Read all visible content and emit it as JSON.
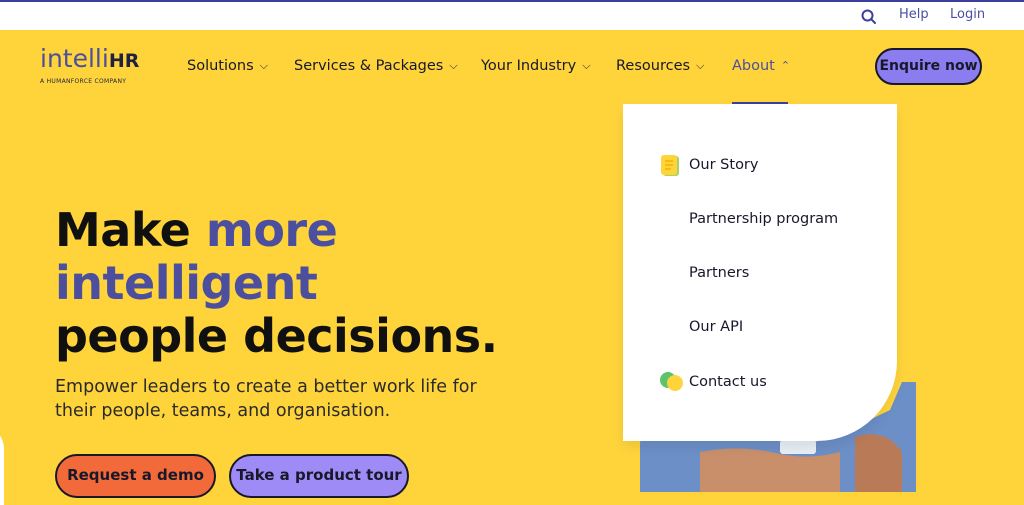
{
  "utility": {
    "search_icon": "search-icon",
    "help": "Help",
    "login": "Login"
  },
  "header": {
    "logo_main": "intelli",
    "logo_bold": "HR",
    "logo_sub": "A HUMANFORCE COMPANY",
    "nav": [
      "Solutions",
      "Services & Packages",
      "Your Industry",
      "Resources",
      "About"
    ],
    "enquire": "Enquire now"
  },
  "dropdown": {
    "items": [
      "Our Story",
      "Partnership program",
      "Partners",
      "Our API",
      "Contact us"
    ]
  },
  "hero": {
    "line1_a": "Make ",
    "line1_b": "more",
    "line2": "intelligent",
    "line3": "people decisions.",
    "sub": "Empower leaders to create a better work life for their people, teams, and organisation.",
    "btn_demo": "Request a demo",
    "btn_tour": "Take a product tour"
  },
  "colors": {
    "brand_yellow": "#ffd43b",
    "brand_indigo": "#4b4f9e",
    "demo_orange": "#f26a3a",
    "tour_purple": "#9f8bf5",
    "enquire_purple": "#8b7cf0"
  }
}
